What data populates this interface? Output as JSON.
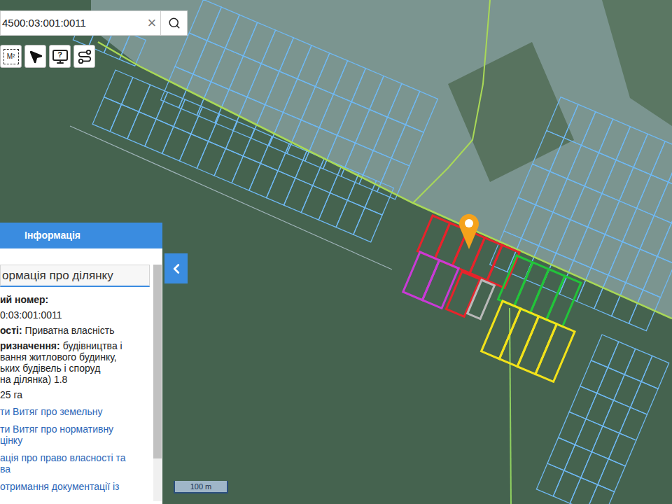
{
  "search": {
    "value": "4500:03:001:0011",
    "clear": "×"
  },
  "toolbar": [
    {
      "kind": "measure",
      "label": "M²"
    },
    {
      "kind": "pointer",
      "label": ""
    },
    {
      "kind": "help",
      "label": "?"
    },
    {
      "kind": "route",
      "label": ""
    }
  ],
  "info_panel": {
    "title": "Інформація",
    "section_title": "ормація про ділянку",
    "lines": [
      {
        "kind": "label",
        "label": "ий номер:",
        "text": ""
      },
      {
        "kind": "value",
        "label": "",
        "text": "0:03:001:0011"
      },
      {
        "kind": "pair",
        "label": "ості:",
        "text": "Приватна власність"
      },
      {
        "kind": "pair",
        "label": "ризначення:",
        "text": "будівництва і"
      },
      {
        "kind": "cont",
        "label": "",
        "text": "вання житлового будинку,"
      },
      {
        "kind": "cont",
        "label": "",
        "text": "ьких будівель і споруд"
      },
      {
        "kind": "cont",
        "label": "",
        "text": "на ділянка) 1.8"
      },
      {
        "kind": "value",
        "label": "",
        "text": "25 га"
      }
    ],
    "links": [
      [
        "ти Витяг про земельну"
      ],
      [
        "ти Витяг про нормативну",
        "цінку"
      ],
      [
        "ація про право власності та",
        "ва"
      ],
      [
        "отримання документації із"
      ]
    ]
  },
  "highlighted_parcels": [
    {
      "color": "#e8232b",
      "count": 5
    },
    {
      "color": "#c93ad6",
      "count": 2
    },
    {
      "color": "#e8232b",
      "count": 1
    },
    {
      "color": "#b9b9b9",
      "count": 1
    },
    {
      "color": "#22c43a",
      "count": 4
    },
    {
      "color": "#f2e21a",
      "count": 4
    }
  ],
  "scale": "100 m"
}
